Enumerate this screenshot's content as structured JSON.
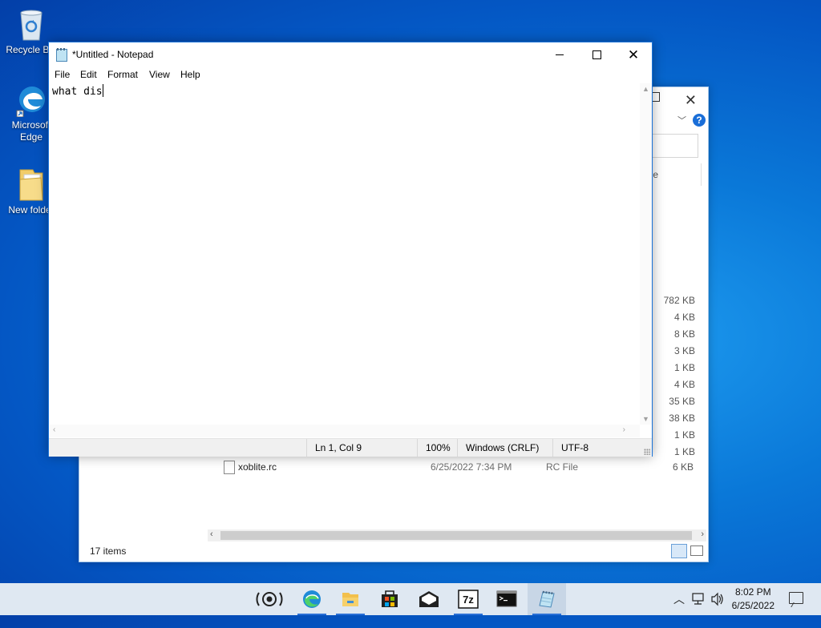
{
  "desktop": {
    "icons": [
      {
        "label": "Recycle Bin"
      },
      {
        "label": "Microsoft Edge"
      },
      {
        "label": "New folder"
      }
    ]
  },
  "explorer": {
    "column_header_fragment": "e",
    "sizes": [
      "782 KB",
      "4 KB",
      "8 KB",
      "3 KB",
      "1 KB",
      "4 KB",
      "35 KB",
      "38 KB",
      "1 KB",
      "1 KB"
    ],
    "visible_file": {
      "name": "xoblite.rc",
      "date": "6/25/2022 7:34 PM",
      "type": "RC File",
      "size": "6 KB"
    },
    "status": "17 items",
    "help_label": "?"
  },
  "notepad": {
    "title": "*Untitled - Notepad",
    "menu": [
      "File",
      "Edit",
      "Format",
      "View",
      "Help"
    ],
    "content": "what dis",
    "status": {
      "position": "Ln 1, Col 9",
      "zoom": "100%",
      "line_ending": "Windows (CRLF)",
      "encoding": "UTF-8"
    }
  },
  "taskbar": {
    "apps": [
      {
        "icon": "cortana-ring-icon"
      },
      {
        "icon": "edge-icon"
      },
      {
        "icon": "file-explorer-icon"
      },
      {
        "icon": "store-icon"
      },
      {
        "icon": "mail-icon"
      },
      {
        "icon": "7zip-icon",
        "label": "7z"
      },
      {
        "icon": "terminal-icon"
      },
      {
        "icon": "notepad-icon"
      }
    ],
    "time": "8:02 PM",
    "date": "6/25/2022"
  },
  "colors": {
    "accent": "#2a6fd6",
    "taskbar_bg": "#dfe8f2",
    "desktop_blue": "#0a78d8"
  }
}
